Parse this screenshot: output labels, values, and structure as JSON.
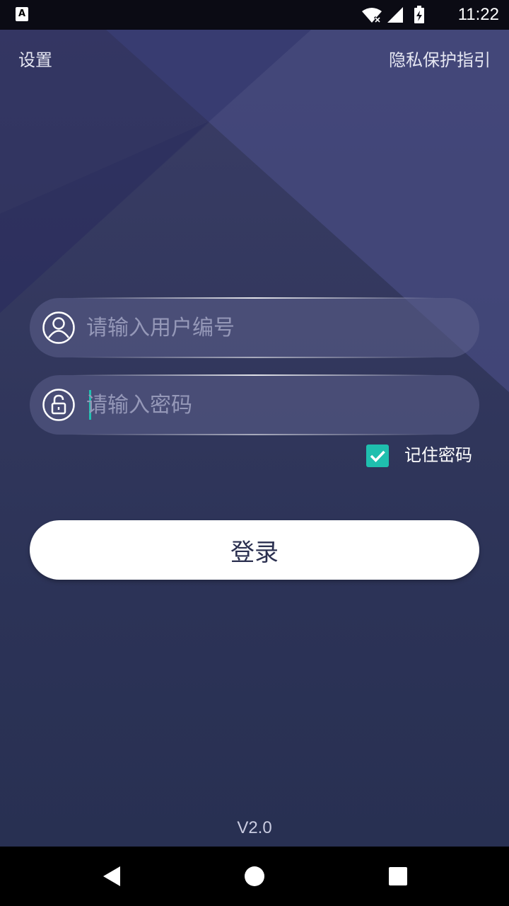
{
  "status_bar": {
    "badge": "A",
    "time": "11:22",
    "icons": [
      "wifi-off-icon",
      "cellular-signal-icon",
      "battery-charging-icon"
    ]
  },
  "header": {
    "settings_label": "设置",
    "privacy_label": "隐私保护指引"
  },
  "login_form": {
    "username": {
      "value": "",
      "placeholder": "请输入用户编号",
      "icon": "user-icon"
    },
    "password": {
      "value": "",
      "placeholder": "请输入密码",
      "icon": "lock-icon"
    },
    "remember": {
      "label": "记住密码",
      "checked": true
    },
    "submit_label": "登录"
  },
  "footer": {
    "version": "V2.0"
  },
  "nav_bar": {
    "items": [
      "back-icon",
      "home-icon",
      "recents-icon"
    ]
  },
  "colors": {
    "accent": "#1fbfae",
    "background_top": "#3a3d66",
    "background_bottom": "#283052",
    "button_text": "#2b3050"
  }
}
